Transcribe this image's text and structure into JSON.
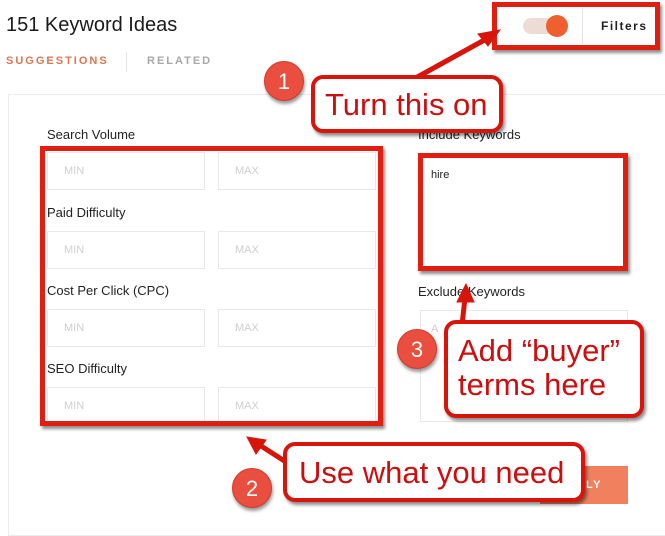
{
  "header": {
    "title": "151 Keyword Ideas",
    "tabs": [
      {
        "label": "SUGGESTIONS",
        "active": true
      },
      {
        "label": "RELATED",
        "active": false
      }
    ],
    "filters_toggle": {
      "on": true,
      "label": "Filters"
    }
  },
  "filters": {
    "search_volume": {
      "label": "Search Volume",
      "min_placeholder": "MIN",
      "max_placeholder": "MAX"
    },
    "paid_difficulty": {
      "label": "Paid Difficulty",
      "min_placeholder": "MIN",
      "max_placeholder": "MAX"
    },
    "cpc": {
      "label": "Cost Per Click (CPC)",
      "min_placeholder": "MIN",
      "max_placeholder": "MAX"
    },
    "seo_difficulty": {
      "label": "SEO Difficulty",
      "min_placeholder": "MIN",
      "max_placeholder": "MAX"
    },
    "include_keywords": {
      "label": "Include Keywords",
      "value": "hire"
    },
    "exclude_keywords": {
      "label": "Exclude Keywords",
      "placeholder": "A"
    },
    "apply_label": "LY"
  },
  "annotations": {
    "callout_1": {
      "number": "1",
      "text": "Turn this on"
    },
    "callout_2": {
      "number": "2",
      "text": "Use what you need"
    },
    "callout_3": {
      "number": "3",
      "line1": "Add “buyer”",
      "line2": "terms here"
    }
  },
  "colors": {
    "accent": "#f0602f",
    "tab_active": "#d9774f",
    "annotation_red": "#e01e12",
    "apply_button": "#f0805e"
  }
}
